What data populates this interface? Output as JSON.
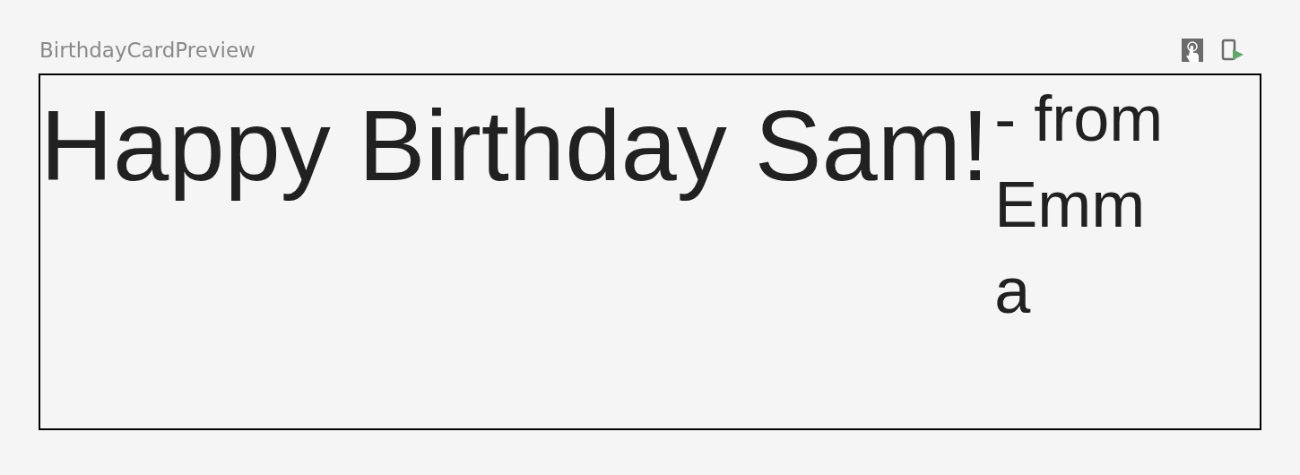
{
  "preview": {
    "title": "BirthdayCardPreview"
  },
  "card": {
    "greeting": "Happy Birthday Sam!",
    "signature": "- from Emma"
  }
}
